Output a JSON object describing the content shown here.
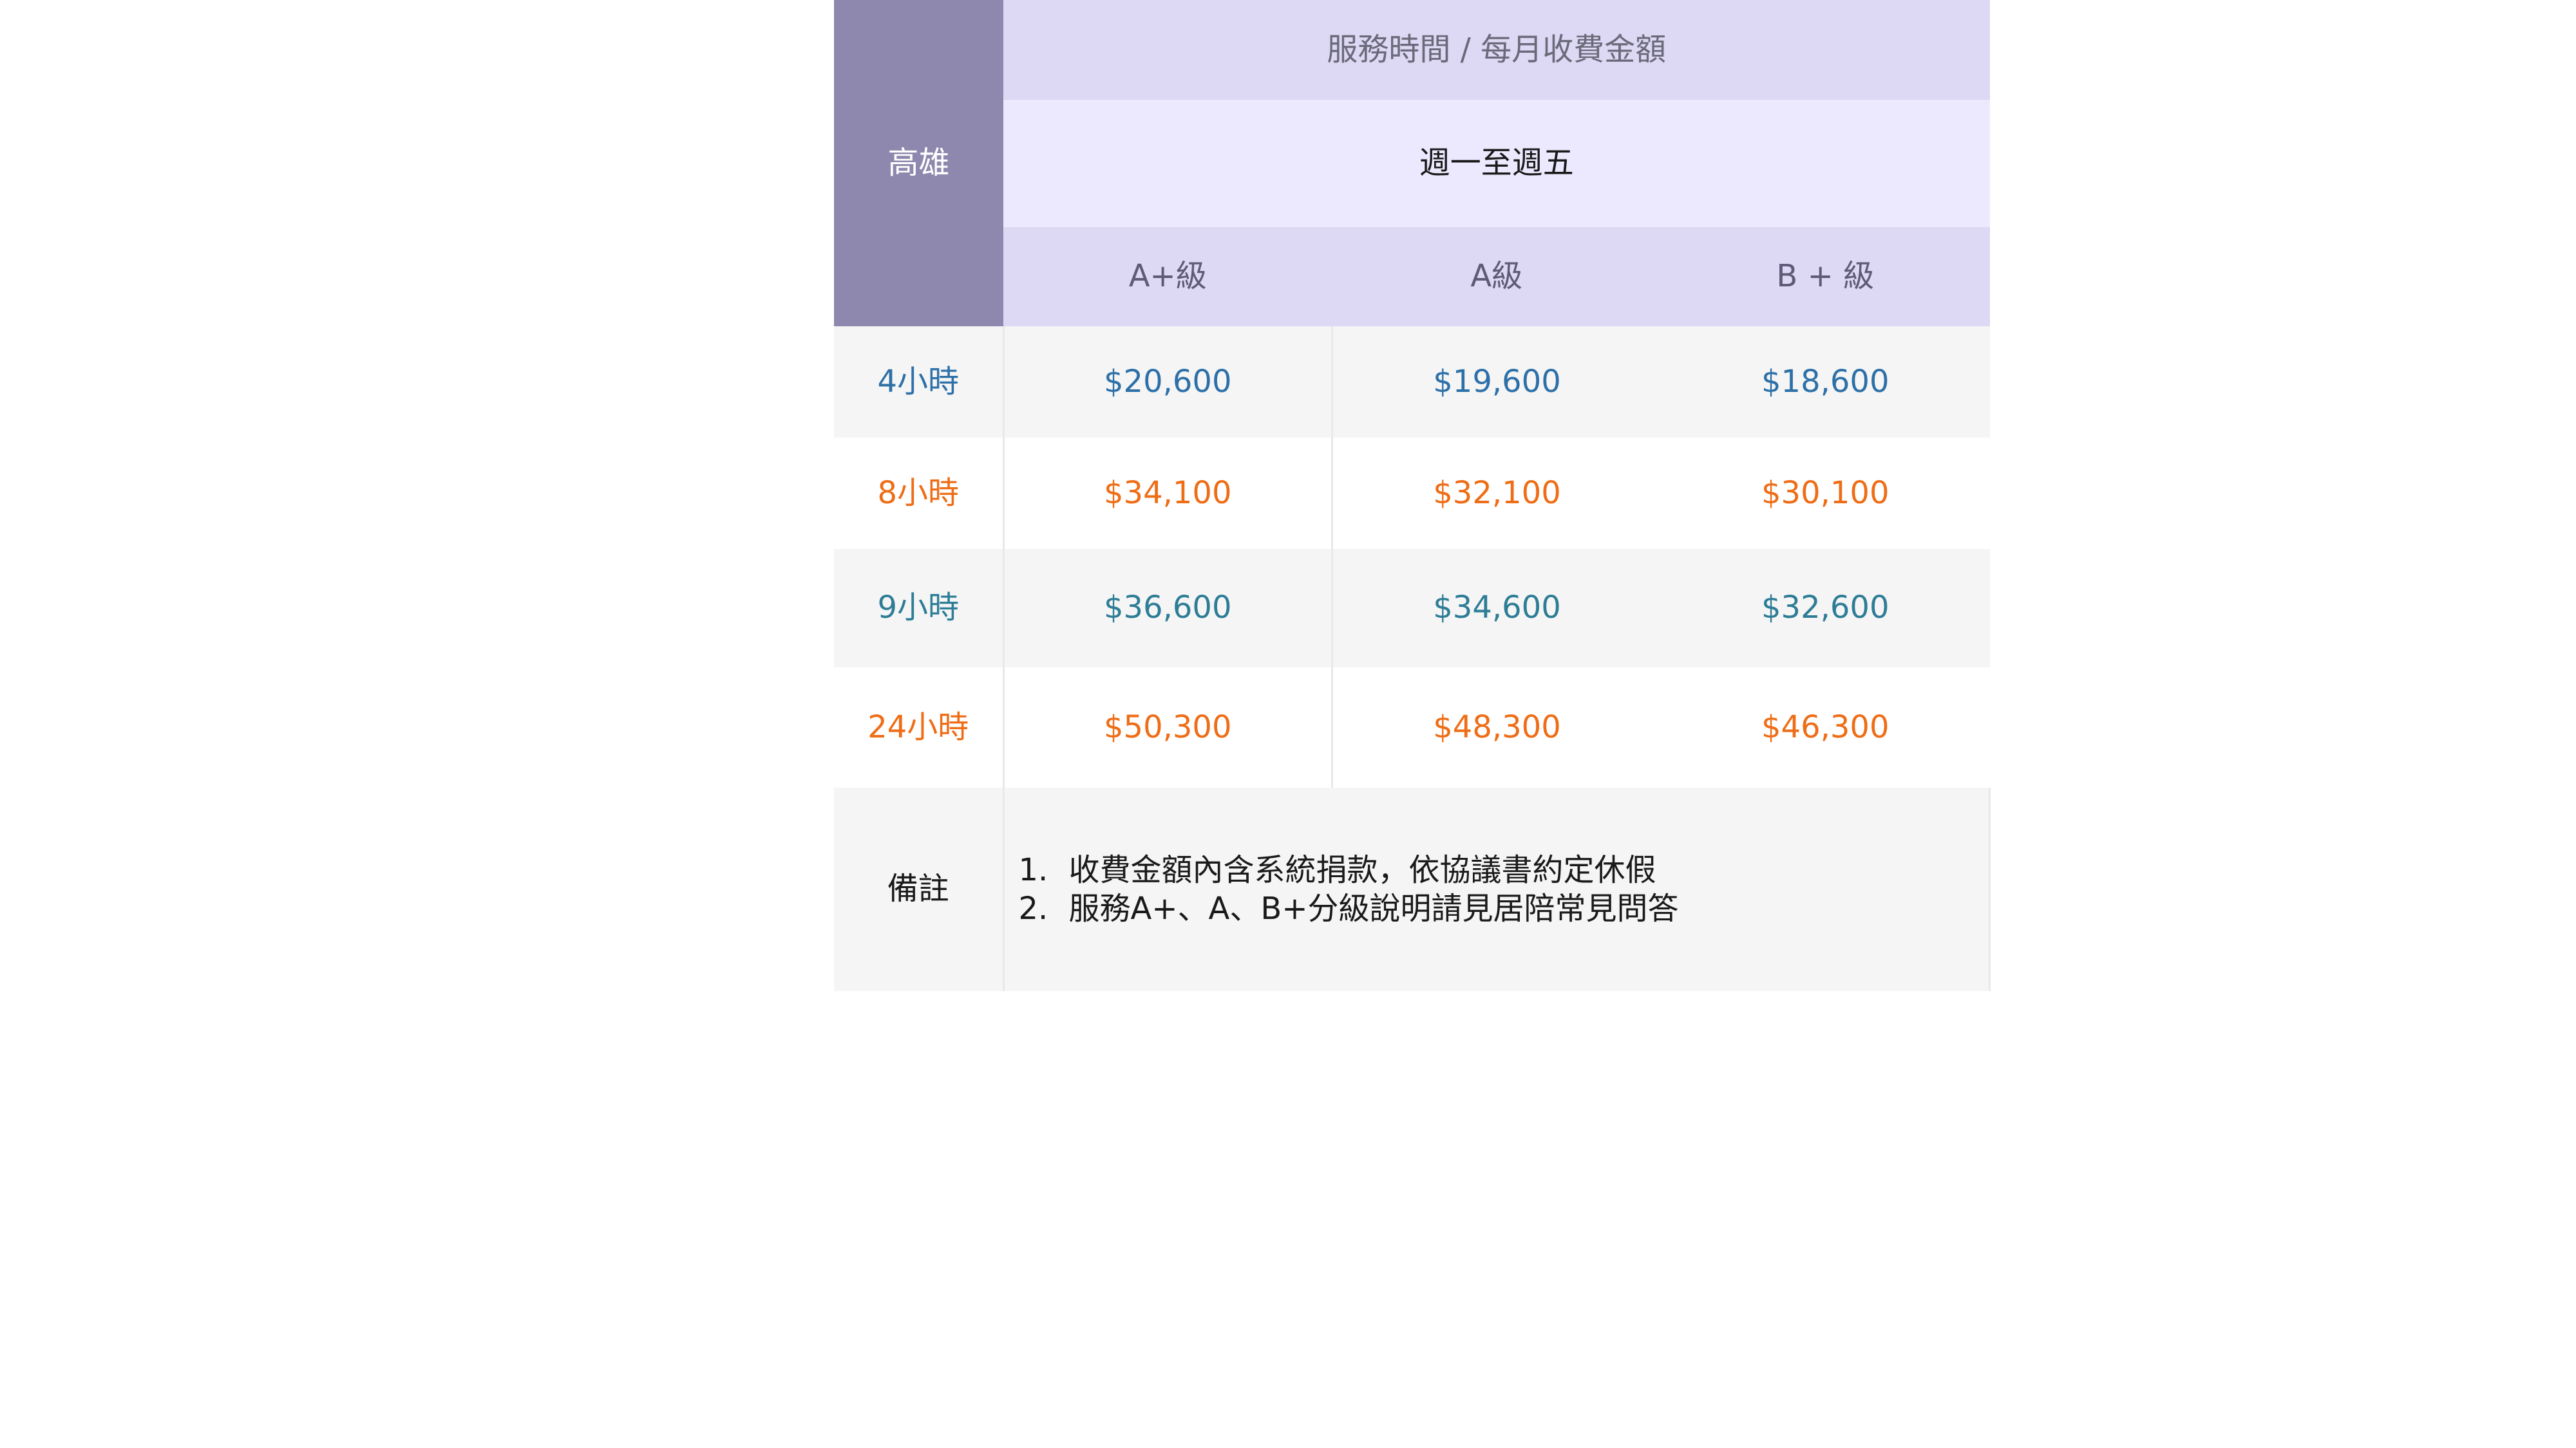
{
  "table": {
    "city": "高雄",
    "title": "服務時間 / 每月收費金額",
    "schedule": "週一至週五",
    "grades": [
      "A+級",
      "A級",
      "B + 級"
    ],
    "rows": [
      {
        "duration": "4小時",
        "prices": [
          "$20,600",
          "$19,600",
          "$18,600"
        ],
        "color": "#2d70a8"
      },
      {
        "duration": "8小時",
        "prices": [
          "$34,100",
          "$32,100",
          "$30,100"
        ],
        "color": "#ee6d16"
      },
      {
        "duration": "9小時",
        "prices": [
          "$36,600",
          "$34,600",
          "$32,600"
        ],
        "color": "#2d7d96"
      },
      {
        "duration": "24小時",
        "prices": [
          "$50,300",
          "$48,300",
          "$46,300"
        ],
        "color": "#ee6d16"
      }
    ],
    "notes_label": "備註",
    "notes": [
      {
        "num": "1.",
        "text": "收費金額內含系統捐款，依協議書約定休假"
      },
      {
        "num": "2.",
        "text": "服務A+、A、B+分級說明請見居陪常見問答"
      }
    ]
  },
  "colors": {
    "header_dark": "#8f88ae",
    "header_light": "#ddd8f3",
    "header_lighter": "#ece9fe",
    "row_gray": "#f5f5f5"
  }
}
